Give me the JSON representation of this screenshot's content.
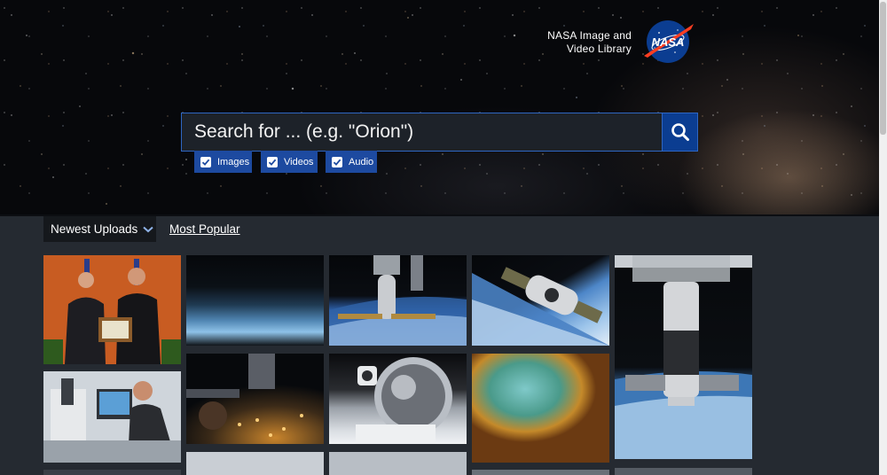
{
  "header": {
    "brand_line1": "NASA Image and",
    "brand_line2": "Video Library",
    "logo_icon": "nasa-meatball-logo"
  },
  "search": {
    "placeholder": "Search for ... (e.g. \"Orion\")",
    "button_icon": "search-icon",
    "filters": [
      {
        "label": "Images",
        "checked": true
      },
      {
        "label": "Videos",
        "checked": true
      },
      {
        "label": "Audio",
        "checked": true
      }
    ]
  },
  "tabs": {
    "newest": "Newest Uploads",
    "newest_icon": "chevron-down-icon",
    "popular": "Most Popular"
  },
  "colors": {
    "accent": "#0b3d91",
    "chip": "#1d4aa0",
    "page_bg": "#252a31"
  },
  "results": [
    {
      "subject": "award-presentation-photo"
    },
    {
      "subject": "earth-horizon-night-photo"
    },
    {
      "subject": "spacecraft-docked-over-earth-photo"
    },
    {
      "subject": "progress-spacecraft-approach-photo"
    },
    {
      "subject": "space-station-module-photo"
    },
    {
      "subject": "lab-microscope-researcher-photo"
    },
    {
      "subject": "city-lights-from-orbit-photo"
    },
    {
      "subject": "astronaut-helmet-reflection-photo"
    },
    {
      "subject": "nebula-hubble-photo"
    }
  ]
}
